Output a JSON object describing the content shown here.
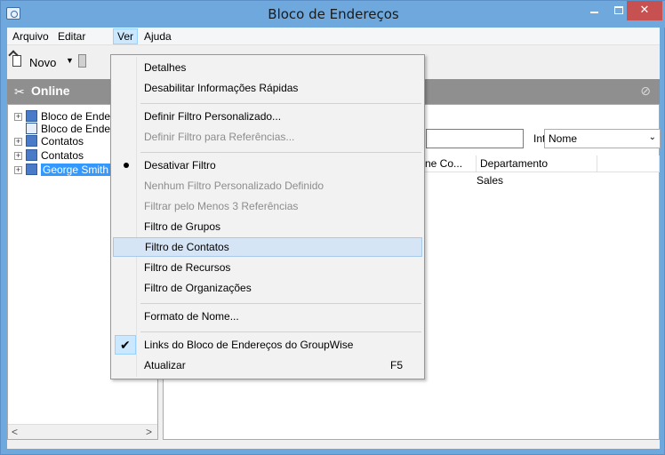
{
  "window": {
    "title": "Bloco de Endereços",
    "min_glyph": "–",
    "close_glyph": "✕"
  },
  "menubar": [
    "Arquivo",
    "Editar",
    "Ver",
    "Ajuda"
  ],
  "toolbar": {
    "new_label": "Novo",
    "new_arrow": "▼"
  },
  "online_bar": {
    "label": "Online"
  },
  "tree": {
    "items": [
      {
        "label": "Bloco de Endereços",
        "expander": "+"
      },
      {
        "label": "Bloco de Endereços",
        "expander": ""
      },
      {
        "label": "Contatos",
        "expander": "+"
      },
      {
        "label": "Contatos",
        "expander": "+"
      },
      {
        "label": "George Smith",
        "expander": "+"
      }
    ],
    "scroll_left": "<",
    "scroll_right": ">"
  },
  "right_panel": {
    "interno_label": "Interno:",
    "interno_value": "Nome",
    "columns": [
      "ne Co...",
      "Departamento"
    ],
    "row": [
      "Sales"
    ]
  },
  "ver_menu": {
    "items": [
      "Detalhes",
      "Desabilitar Informações Rápidas",
      "Definir Filtro Personalizado...",
      "Definir Filtro para Referências...",
      "Desativar Filtro",
      "Nenhum Filtro Personalizado Definido",
      "Filtrar pelo Menos 3 Referências",
      "Filtro de Grupos",
      "Filtro de Contatos",
      "Filtro de Recursos",
      "Filtro de Organizações",
      "Formato de Nome...",
      "Links do Bloco de Endereços do GroupWise",
      "Atualizar"
    ],
    "refresh_shortcut": "F5",
    "check_glyph": "✔"
  }
}
